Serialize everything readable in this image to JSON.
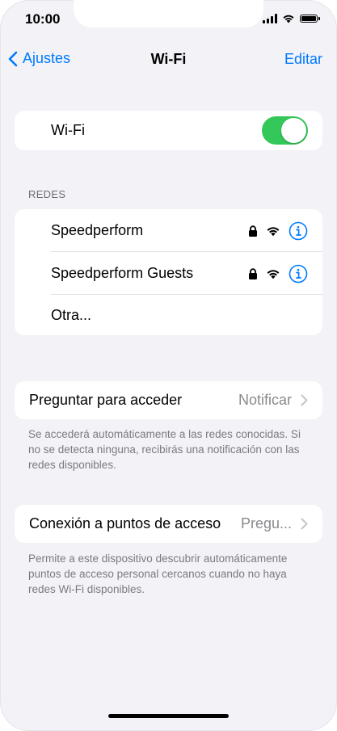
{
  "status_bar": {
    "time": "10:00"
  },
  "nav": {
    "back_label": "Ajustes",
    "title": "Wi-Fi",
    "edit_label": "Editar"
  },
  "wifi": {
    "label": "Wi-Fi",
    "enabled": true
  },
  "networks": {
    "header": "REDES",
    "items": [
      {
        "name": "Speedperform",
        "secured": true
      },
      {
        "name": "Speedperform Guests",
        "secured": true
      }
    ],
    "other_label": "Otra..."
  },
  "ask_to_join": {
    "label": "Preguntar para acceder",
    "value": "Notificar",
    "footer": "Se accederá automáticamente a las redes conocidas. Si no se detecta ninguna, recibirás una notificación con las redes disponibles."
  },
  "hotspot": {
    "label": "Conexión a puntos de acceso",
    "value": "Pregu...",
    "footer": "Permite a este dispositivo descubrir automáticamente puntos de acceso personal cercanos cuando no haya redes Wi-Fi disponibles."
  },
  "colors": {
    "accent": "#007aff",
    "toggle_on": "#34c759",
    "background": "#f2f2f7"
  }
}
